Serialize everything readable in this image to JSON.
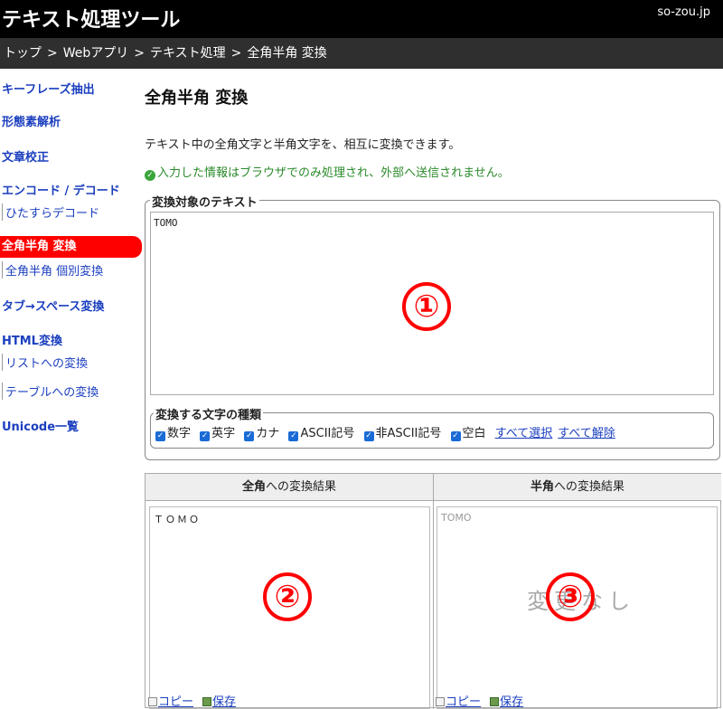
{
  "header": {
    "site_title": "テキスト処理ツール",
    "domain": "so-zou.jp"
  },
  "breadcrumb": {
    "items": [
      "トップ",
      "Webアプリ",
      "テキスト処理",
      "全角半角 変換"
    ],
    "separator": ">"
  },
  "sidebar": {
    "items": [
      {
        "label": "キーフレーズ抽出"
      },
      {
        "label": "形態素解析"
      },
      {
        "label": "文章校正"
      },
      {
        "label": "エンコード / デコード"
      },
      {
        "label": "ひたすらデコード"
      },
      {
        "label": "全角半角 変換"
      },
      {
        "label": "全角半角 個別変換"
      },
      {
        "label": "タブ→スペース変換"
      },
      {
        "label": "HTML変換"
      },
      {
        "label": "リストへの変換"
      },
      {
        "label": "テーブルへの変換"
      },
      {
        "label": "Unicode一覧"
      }
    ],
    "active_color": "#ff0000"
  },
  "main": {
    "title": "全角半角 変換",
    "description": "テキスト中の全角文字と半角文字を、相互に変換できます。",
    "privacy_note": "入力した情報はブラウザでのみ処理され、外部へ送信されません。",
    "input_legend": "変換対象のテキスト",
    "input_value": "TOMO",
    "options_legend": "変換する文字の種類",
    "options": [
      "数字",
      "英字",
      "カナ",
      "ASCII記号",
      "非ASCII記号",
      "空白"
    ],
    "select_all": "すべて選択",
    "deselect_all": "すべて解除"
  },
  "results": {
    "left": {
      "head_bold": "全角",
      "head_rest": "への変換結果",
      "value": "ＴＯＭＯ"
    },
    "right": {
      "head_bold": "半角",
      "head_rest": "への変換結果",
      "value": "TOMO",
      "ghost": "変更なし"
    },
    "copy_label": "コピー",
    "save_label": "保存"
  },
  "markers": [
    "①",
    "②",
    "③"
  ],
  "colors": {
    "accent": "#ff0000",
    "link": "#1b3fbf",
    "note": "#2a8a2a"
  }
}
